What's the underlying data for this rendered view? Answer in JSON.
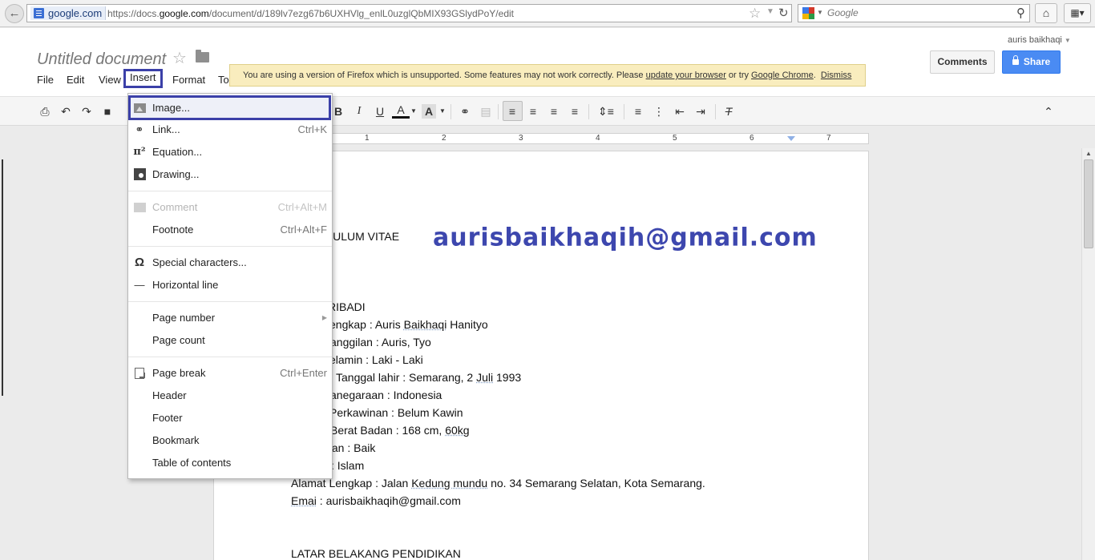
{
  "browser": {
    "site_label": "google.com",
    "url_prefix": "https://docs.",
    "url_domain": "google.com",
    "url_path": "/document/d/189lv7ezg67b6UXHVlg_enlL0uzglQbMIX93GSlydPoY/edit",
    "search_placeholder": "Google"
  },
  "doc": {
    "title": "Untitled document",
    "user": "auris baikhaqi",
    "comments_label": "Comments",
    "share_label": "Share"
  },
  "menubar": [
    "File",
    "Edit",
    "View",
    "Insert",
    "Format",
    "To"
  ],
  "warning": {
    "text": "You are using a version of Firefox which is unsupported. Some features may not work correctly. Please ",
    "link1": "update your browser",
    "mid": " or try ",
    "link2": "Google Chrome",
    "end": ".",
    "dismiss": "Dismiss"
  },
  "toolbar": {
    "bold": "B",
    "italic": "I",
    "underline": "U",
    "text_color": "A",
    "highlight": "A"
  },
  "ruler": [
    "1",
    "2",
    "3",
    "4",
    "5",
    "6",
    "7"
  ],
  "insert_menu": {
    "image": {
      "label": "Image..."
    },
    "link": {
      "label": "Link...",
      "shortcut": "Ctrl+K"
    },
    "equation": {
      "label": "Equation..."
    },
    "drawing": {
      "label": "Drawing..."
    },
    "comment": {
      "label": "Comment",
      "shortcut": "Ctrl+Alt+M"
    },
    "footnote": {
      "label": "Footnote",
      "shortcut": "Ctrl+Alt+F"
    },
    "special_chars": {
      "label": "Special characters..."
    },
    "horizontal_line": {
      "label": "Horizontal line"
    },
    "page_number": {
      "label": "Page number"
    },
    "page_count": {
      "label": "Page count"
    },
    "page_break": {
      "label": "Page break",
      "shortcut": "Ctrl+Enter"
    },
    "header": {
      "label": "Header"
    },
    "footer": {
      "label": "Footer"
    },
    "bookmark": {
      "label": "Bookmark"
    },
    "toc": {
      "label": "Table of contents"
    }
  },
  "document_lines": {
    "cv_title": "CULUM VITAE",
    "data_pribadi": "RIBADI",
    "nama_a": "engkap : Auris ",
    "nama_b": "Baikhaqi",
    "nama_c": " Hanityo",
    "panggilan": "anggilan : Auris, Tyo",
    "kelamin": "elamin : Laki - Laki",
    "ttl_a": "Tanggal lahir : Semarang, 2 ",
    "ttl_b": "Juli",
    "ttl_c": " 1993",
    "kewarganegaraan": "anegaraan : Indonesia",
    "status": "Perkawinan : Belum Kawin",
    "bb_a": "Berat Badan : 168 cm, ",
    "bb_b": "60kg",
    "kesehatan": "tan : Baik",
    "agama": ": Islam",
    "alamat_a": "Alamat Lengkap : Jalan ",
    "alamat_b": "Kedung mundu",
    "alamat_c": " no. 34 Semarang Selatan, Kota Semarang.",
    "email_a": "Emai",
    "email_b": " : aurisbaikhaqih@gmail.com",
    "pendidikan": "LATAR BELAKANG PENDIDIKAN"
  },
  "watermark": "aurisbaikhaqih@gmail.com",
  "colors": {
    "accent_border": "#3b40a8",
    "watermark": "#3d47ae",
    "share": "#4a8bf3"
  }
}
